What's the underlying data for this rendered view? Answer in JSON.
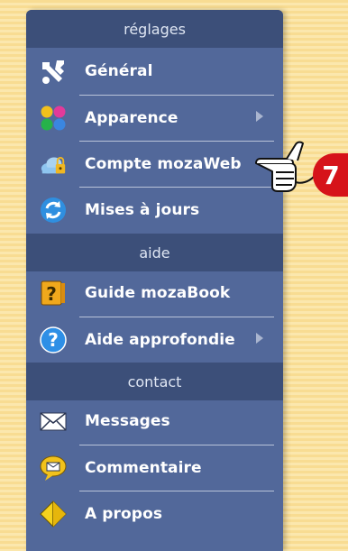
{
  "sections": {
    "settings": "réglages",
    "help": "aide",
    "contact": "contact"
  },
  "items": {
    "general": {
      "label": "Général",
      "icon": "tools-icon"
    },
    "appearance": {
      "label": "Apparence",
      "icon": "color-dots-icon",
      "submenu": true
    },
    "account": {
      "label": "Compte mozaWeb",
      "icon": "cloud-lock-icon"
    },
    "updates": {
      "label": "Mises à jours",
      "icon": "refresh-icon"
    },
    "guide": {
      "label": "Guide mozaBook",
      "icon": "guide-book-icon"
    },
    "advanced_help": {
      "label": "Aide approfondie",
      "icon": "help-icon",
      "submenu": true
    },
    "messages": {
      "label": "Messages",
      "icon": "envelope-icon"
    },
    "feedback": {
      "label": "Commentaire",
      "icon": "speech-bubble-icon"
    },
    "about": {
      "label": "A propos",
      "icon": "about-diamond-icon"
    }
  },
  "callout": {
    "number": "7"
  },
  "colors": {
    "menu_bg": "#52689a",
    "header_bg": "#3c4f79",
    "badge": "#d6131a",
    "background": "#f8dc92"
  }
}
